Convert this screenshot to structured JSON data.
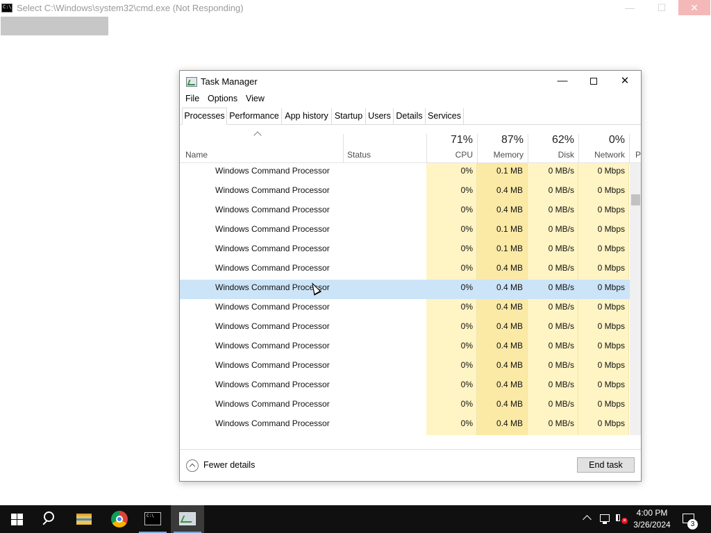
{
  "cmd_window": {
    "title": "Select C:\\Windows\\system32\\cmd.exe (Not Responding)",
    "min_symbol": "—",
    "max_symbol": "☐",
    "close_symbol": "✕",
    "icon_text": "C:\\"
  },
  "task_manager": {
    "title": "Task Manager",
    "min_symbol": "—",
    "close_symbol": "✕",
    "menu": [
      "File",
      "Options",
      "View"
    ],
    "tabs": [
      "Processes",
      "Performance",
      "App history",
      "Startup",
      "Users",
      "Details",
      "Services"
    ],
    "active_tab": "Processes",
    "columns": {
      "name": "Name",
      "status": "Status",
      "cpu": {
        "pct": "71%",
        "label": "CPU"
      },
      "memory": {
        "pct": "87%",
        "label": "Memory"
      },
      "disk": {
        "pct": "62%",
        "label": "Disk"
      },
      "network": {
        "pct": "0%",
        "label": "Network"
      },
      "power_partial": "P"
    },
    "rows": [
      {
        "name": "Windows Command Processor",
        "cpu": "0%",
        "memory": "0.1 MB",
        "disk": "0 MB/s",
        "network": "0 Mbps"
      },
      {
        "name": "Windows Command Processor",
        "cpu": "0%",
        "memory": "0.4 MB",
        "disk": "0 MB/s",
        "network": "0 Mbps"
      },
      {
        "name": "Windows Command Processor",
        "cpu": "0%",
        "memory": "0.4 MB",
        "disk": "0 MB/s",
        "network": "0 Mbps"
      },
      {
        "name": "Windows Command Processor",
        "cpu": "0%",
        "memory": "0.1 MB",
        "disk": "0 MB/s",
        "network": "0 Mbps"
      },
      {
        "name": "Windows Command Processor",
        "cpu": "0%",
        "memory": "0.1 MB",
        "disk": "0 MB/s",
        "network": "0 Mbps"
      },
      {
        "name": "Windows Command Processor",
        "cpu": "0%",
        "memory": "0.4 MB",
        "disk": "0 MB/s",
        "network": "0 Mbps"
      },
      {
        "name": "Windows Command Processor",
        "cpu": "0%",
        "memory": "0.4 MB",
        "disk": "0 MB/s",
        "network": "0 Mbps",
        "selected": true
      },
      {
        "name": "Windows Command Processor",
        "cpu": "0%",
        "memory": "0.4 MB",
        "disk": "0 MB/s",
        "network": "0 Mbps"
      },
      {
        "name": "Windows Command Processor",
        "cpu": "0%",
        "memory": "0.4 MB",
        "disk": "0 MB/s",
        "network": "0 Mbps"
      },
      {
        "name": "Windows Command Processor",
        "cpu": "0%",
        "memory": "0.4 MB",
        "disk": "0 MB/s",
        "network": "0 Mbps"
      },
      {
        "name": "Windows Command Processor",
        "cpu": "0%",
        "memory": "0.4 MB",
        "disk": "0 MB/s",
        "network": "0 Mbps"
      },
      {
        "name": "Windows Command Processor",
        "cpu": "0%",
        "memory": "0.4 MB",
        "disk": "0 MB/s",
        "network": "0 Mbps"
      },
      {
        "name": "Windows Command Processor",
        "cpu": "0%",
        "memory": "0.4 MB",
        "disk": "0 MB/s",
        "network": "0 Mbps"
      },
      {
        "name": "Windows Command Processor",
        "cpu": "0%",
        "memory": "0.4 MB",
        "disk": "0 MB/s",
        "network": "0 Mbps"
      }
    ],
    "fewer_details_label": "Fewer details",
    "end_task_label": "End task"
  },
  "taskbar": {
    "items": [
      "start-icon",
      "search-icon",
      "file-explorer-icon",
      "chrome-icon",
      "cmd-icon",
      "task-manager-icon"
    ],
    "clock_time": "4:00 PM",
    "clock_date": "3/26/2024",
    "notification_count": "3"
  },
  "colors": {
    "selection": "#cce4f7",
    "heat_light": "#fff4c4",
    "heat_medium": "#fbe9a6",
    "taskbar": "#101010"
  }
}
